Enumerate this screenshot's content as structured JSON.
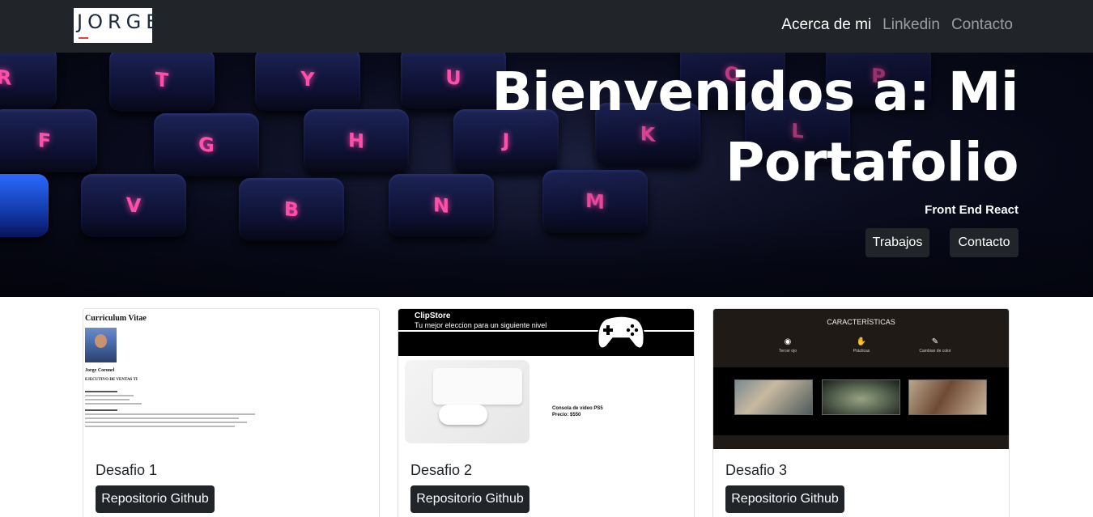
{
  "navbar": {
    "logo_text": "JORGE",
    "links": [
      {
        "label": "Acerca de mi",
        "active": true
      },
      {
        "label": "Linkedin",
        "active": false
      },
      {
        "label": "Contacto",
        "active": false
      }
    ]
  },
  "hero": {
    "title_line1": "Bienvenidos a: Mi",
    "title_line2": "Portafolio",
    "subtitle": "Front End React",
    "buttons": {
      "works": "Trabajos",
      "contact": "Contacto"
    },
    "keyboard_letters": [
      "R",
      "T",
      "Y",
      "U",
      "O",
      "P",
      "F",
      "G",
      "H",
      "J",
      "K",
      "L",
      "V",
      "B",
      "N",
      "M"
    ]
  },
  "cards": [
    {
      "title": "Desafio 1",
      "button": "Repositorio Github",
      "preview": {
        "heading": "Curriculum Vitae",
        "name": "Jorge Coronel",
        "role": "EJECUTIVO DE VENTAS TI"
      }
    },
    {
      "title": "Desafio 2",
      "button": "Repositorio Github",
      "preview": {
        "brand": "ClipStore",
        "tagline": "Tu mejor eleccion para un siguiente nivel",
        "product": "Consola de video PS5",
        "price": "Precio: $550"
      }
    },
    {
      "title": "Desafio 3",
      "button": "Repositorio Github",
      "preview": {
        "heading": "CARACTERÍSTICAS",
        "features": [
          "Tercer ojo",
          "Prácticas",
          "Cambian de color"
        ]
      }
    }
  ],
  "colors": {
    "navbar_bg": "#212529",
    "button_dark": "#212529",
    "key_glow": "#ff4fa8"
  }
}
